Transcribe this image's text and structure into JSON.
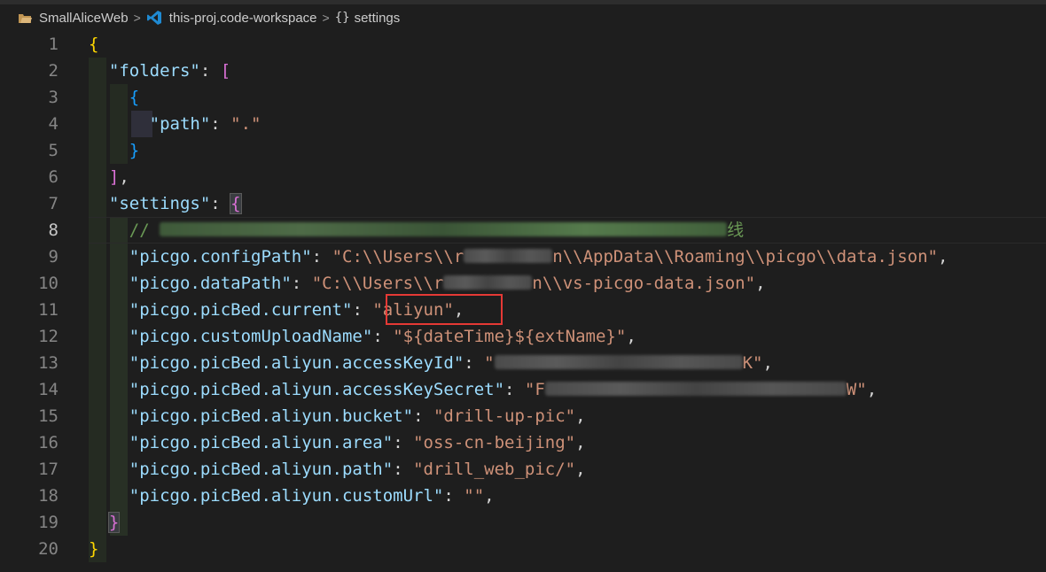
{
  "breadcrumb": {
    "items": [
      {
        "label": "SmallAliceWeb",
        "icon": "folder-icon"
      },
      {
        "label": "this-proj.code-workspace",
        "icon": "vscode-icon"
      },
      {
        "label": "settings",
        "icon": "braces-icon"
      }
    ],
    "braces_glyph": "{}",
    "separator": ">"
  },
  "editor": {
    "active_line": 8,
    "line_numbers": [
      "1",
      "2",
      "3",
      "4",
      "5",
      "6",
      "7",
      "8",
      "9",
      "10",
      "11",
      "12",
      "13",
      "14",
      "15",
      "16",
      "17",
      "18",
      "19",
      "20"
    ],
    "lines": {
      "l1": {
        "open": "{"
      },
      "l2": {
        "key": "\"folders\"",
        "colon": ": ",
        "open": "["
      },
      "l3": {
        "open": "{"
      },
      "l4": {
        "key": "\"path\"",
        "colon": ": ",
        "value": "\".\""
      },
      "l5": {
        "close": "}"
      },
      "l6": {
        "close": "]",
        "comma": ","
      },
      "l7": {
        "key": "\"settings\"",
        "colon": ": ",
        "open": "{"
      },
      "l8": {
        "comment_prefix": "// ",
        "comment_tail": "线",
        "note": "redacted"
      },
      "l9": {
        "key": "\"picgo.configPath\"",
        "colon": ": ",
        "v1": "\"C:\\\\Users\\\\r",
        "v2": "n\\\\AppData\\\\Roaming\\\\picgo\\\\data.json\"",
        "comma": ","
      },
      "l10": {
        "key": "\"picgo.dataPath\"",
        "colon": ": ",
        "v1": "\"C:\\\\Users\\\\r",
        "v2": "n\\\\vs-picgo-data.json\"",
        "comma": ","
      },
      "l11": {
        "key": "\"picgo.picBed.current\"",
        "colon": ": ",
        "value": "\"aliyun\"",
        "comma": ","
      },
      "l12": {
        "key": "\"picgo.customUploadName\"",
        "colon": ": ",
        "value": "\"${dateTime}${extName}\"",
        "comma": ","
      },
      "l13": {
        "key": "\"picgo.picBed.aliyun.accessKeyId\"",
        "colon": ": ",
        "v1": "\"",
        "v2": "K\"",
        "comma": ","
      },
      "l14": {
        "key": "\"picgo.picBed.aliyun.accessKeySecret\"",
        "colon": ": ",
        "v1": "\"F",
        "v2": "W\"",
        "comma": ","
      },
      "l15": {
        "key": "\"picgo.picBed.aliyun.bucket\"",
        "colon": ": ",
        "value": "\"drill-up-pic\"",
        "comma": ","
      },
      "l16": {
        "key": "\"picgo.picBed.aliyun.area\"",
        "colon": ": ",
        "value": "\"oss-cn-beijing\"",
        "comma": ","
      },
      "l17": {
        "key": "\"picgo.picBed.aliyun.path\"",
        "colon": ": ",
        "value": "\"drill_web_pic/\"",
        "comma": ","
      },
      "l18": {
        "key": "\"picgo.picBed.aliyun.customUrl\"",
        "colon": ": ",
        "value": "\"\"",
        "comma": ","
      },
      "l19": {
        "close": "}"
      },
      "l20": {
        "close": "}"
      }
    }
  },
  "colors": {
    "background": "#1e1e1e",
    "key": "#9cdcfe",
    "string": "#ce9178",
    "comment": "#6a9955",
    "bracket_gold": "#ffd700",
    "bracket_pink": "#da70d6",
    "bracket_blue": "#179fff",
    "highlight_box": "#e53935"
  }
}
